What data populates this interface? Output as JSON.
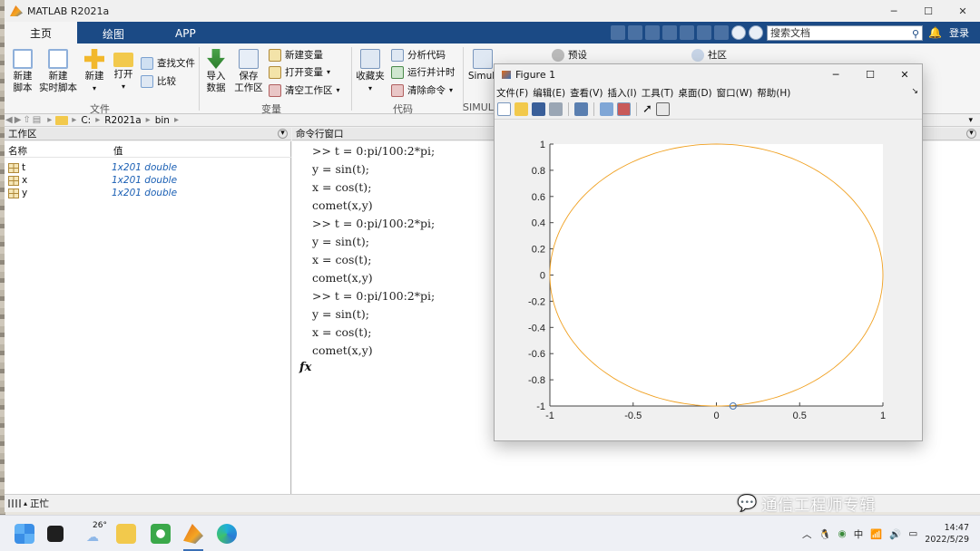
{
  "window": {
    "title": "MATLAB R2021a"
  },
  "tabs": [
    {
      "label": "主页"
    },
    {
      "label": "绘图"
    },
    {
      "label": "APP"
    }
  ],
  "search": {
    "placeholder": "搜索文档"
  },
  "header": {
    "login": "登录"
  },
  "ribbon": {
    "file": {
      "new_script": "新建\n脚本",
      "new_live_script": "新建\n实时脚本",
      "new": "新建",
      "open": "打开",
      "find_files": "查找文件",
      "compare": "比较",
      "group": "文件"
    },
    "variable": {
      "import": "导入\n数据",
      "save": "保存\n工作区",
      "new_var": "新建变量",
      "open_var": "打开变量",
      "clear_ws": "清空工作区",
      "group": "变量"
    },
    "code": {
      "favorites": "收藏夹",
      "analyze": "分析代码",
      "run_time": "运行并计时",
      "clear_cmd": "清除命令",
      "group": "代码"
    },
    "simulink": {
      "label": "Simuli",
      "group": "SIMUL"
    },
    "env": {
      "prefs": "预设"
    },
    "resources": {
      "community": "社区"
    }
  },
  "address": {
    "path": [
      "C:",
      "R2021a",
      "bin"
    ]
  },
  "workspace": {
    "title": "工作区",
    "col_name": "名称",
    "col_value": "值",
    "rows": [
      {
        "name": "t",
        "value": "1x201 double"
      },
      {
        "name": "x",
        "value": "1x201 double"
      },
      {
        "name": "y",
        "value": "1x201 double"
      }
    ]
  },
  "command_window": {
    "title": "命令行窗口",
    "lines": [
      ">> t = 0:pi/100:2*pi;",
      "y = sin(t);",
      "x = cos(t);",
      "comet(x,y)",
      ">> t = 0:pi/100:2*pi;",
      "y = sin(t);",
      "x = cos(t);",
      "comet(x,y)",
      ">> t = 0:pi/100:2*pi;",
      "y = sin(t);",
      "x = cos(t);",
      "comet(x,y)"
    ],
    "prompt_icon": "fx"
  },
  "status": {
    "text": "正忙"
  },
  "figure": {
    "title": "Figure 1",
    "menu": [
      "文件(F)",
      "编辑(E)",
      "查看(V)",
      "插入(I)",
      "工具(T)",
      "桌面(D)",
      "窗口(W)",
      "帮助(H)"
    ]
  },
  "chart_data": {
    "type": "line",
    "series": [
      {
        "kind": "comet trail",
        "t_start": 0,
        "t_end": 6.2832,
        "x": "cos(t)",
        "y": "sin(t)",
        "color": "#f0a020"
      }
    ],
    "marker": {
      "x": 0.1,
      "y": -1.0
    },
    "xlim": [
      -1,
      1
    ],
    "ylim": [
      -1,
      1
    ],
    "xticks": [
      "-1",
      "-0.5",
      "0",
      "0.5",
      "1"
    ],
    "yticks": [
      "1",
      "0.8",
      "0.6",
      "0.4",
      "0.2",
      "0",
      "-0.2",
      "-0.4",
      "-0.6",
      "-0.8",
      "-1"
    ]
  },
  "taskbar": {
    "weather": "26°",
    "ime": "中",
    "time": "14:47",
    "date": "2022/5/29"
  },
  "watermark": {
    "text": "通信工程师专辑"
  },
  "colors": {
    "tabbar": "#1b4a85",
    "trail": "#f0a020",
    "marker": "#4a78b5"
  }
}
